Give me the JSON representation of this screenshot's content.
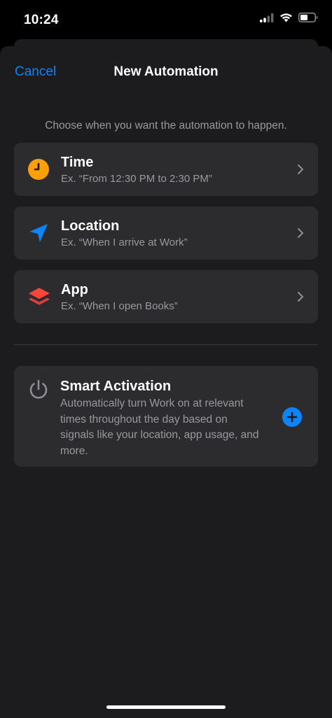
{
  "status_bar": {
    "time": "10:24",
    "icons": [
      "cellular-signal-icon",
      "wifi-icon",
      "battery-icon"
    ]
  },
  "nav": {
    "cancel_label": "Cancel",
    "title": "New Automation"
  },
  "subtitle": "Choose when you want the automation to happen.",
  "options": [
    {
      "title": "Time",
      "description": "Ex. “From 12:30 PM to 2:30 PM”",
      "icon": "clock-icon",
      "icon_color": "#ff9f0a"
    },
    {
      "title": "Location",
      "description": "Ex. “When I arrive at Work”",
      "icon": "location-arrow-icon",
      "icon_color": "#0a84ff"
    },
    {
      "title": "App",
      "description": "Ex. “When I open Books”",
      "icon": "app-layers-icon",
      "icon_color": "#ff453a"
    }
  ],
  "smart_activation": {
    "title": "Smart Activation",
    "description": "Automatically turn Work on at relevant times throughout the day based on signals like your location, app usage, and more.",
    "icon": "power-icon",
    "action_icon": "plus-circle-icon"
  },
  "colors": {
    "accent": "#0a84ff",
    "background": "#1c1c1e",
    "card": "#2c2c2e",
    "secondary_text": "#98989f"
  }
}
